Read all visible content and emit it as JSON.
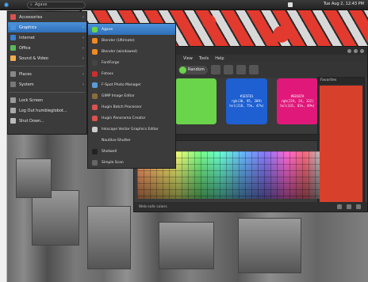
{
  "colors": {
    "accent": "#3a7fd0",
    "scheme_green": "#6ad44a",
    "swatch_blue": "#1e5fd1",
    "swatch_magenta": "#e0187a",
    "swatch_red": "#d7412c",
    "menu_bg": "#3b3b3b"
  },
  "topbar": {
    "search_label": "Agave",
    "clock": "Tue Aug 2, 12:43 PM"
  },
  "menu": {
    "items": [
      {
        "label": "Accessories",
        "icon": "accessories-icon",
        "color": "#d9534f",
        "submenu": true
      },
      {
        "label": "Graphics",
        "icon": "graphics-icon",
        "color": "#4a90d9",
        "submenu": true,
        "active": true
      },
      {
        "label": "Internet",
        "icon": "internet-icon",
        "color": "#3a7fd0",
        "submenu": true
      },
      {
        "label": "Office",
        "icon": "office-icon",
        "color": "#5cb85c",
        "submenu": true
      },
      {
        "label": "Sound & Video",
        "icon": "media-icon",
        "color": "#f0ad4e",
        "submenu": true
      },
      {
        "label": "Places",
        "icon": "folder-icon",
        "color": "#888888",
        "submenu": true
      },
      {
        "label": "System",
        "icon": "system-icon",
        "color": "#777777",
        "submenu": true
      },
      {
        "label": "Lock Screen",
        "icon": "lock-icon",
        "color": "#999999",
        "submenu": false
      },
      {
        "label": "Log Out humbleglobot...",
        "icon": "logout-icon",
        "color": "#aaaaaa",
        "submenu": false
      },
      {
        "label": "Shut Down...",
        "icon": "power-icon",
        "color": "#bbbbbb",
        "submenu": false
      }
    ]
  },
  "submenu": {
    "items": [
      {
        "label": "Agave",
        "icon": "agave-icon",
        "color": "#6ad44a",
        "active": true
      },
      {
        "label": "Blender (Ultimate)",
        "icon": "blender-icon",
        "color": "#f08a24"
      },
      {
        "label": "Blender (windowed)",
        "icon": "blender-icon",
        "color": "#f08a24"
      },
      {
        "label": "FontForge",
        "icon": "fontforge-icon",
        "color": "#444444"
      },
      {
        "label": "Fotoxx",
        "icon": "fotoxx-icon",
        "color": "#c9302c"
      },
      {
        "label": "F-Spot Photo Manager",
        "icon": "fspot-icon",
        "color": "#5b9bd5"
      },
      {
        "label": "GIMP Image Editor",
        "icon": "gimp-icon",
        "color": "#8a6d3b"
      },
      {
        "label": "Hugin Batch Processor",
        "icon": "hugin-icon",
        "color": "#d9534f"
      },
      {
        "label": "Hugin Panorama Creator",
        "icon": "hugin-icon",
        "color": "#d9534f"
      },
      {
        "label": "Inkscape Vector Graphics Editor",
        "icon": "inkscape-icon",
        "color": "#cccccc"
      },
      {
        "label": "Nautilus-Shutter",
        "icon": "shutter-icon",
        "color": "#3a3a3a"
      },
      {
        "label": "Shotwell",
        "icon": "shotwell-icon",
        "color": "#222222"
      },
      {
        "label": "Simple Scan",
        "icon": "scan-icon",
        "color": "#666666"
      }
    ]
  },
  "app": {
    "menubar": [
      "View",
      "Tools",
      "Help"
    ],
    "scheme_button": "Random",
    "swatches": [
      {
        "hex": "#1E5FD1",
        "line2": "rgb(30, 95, 209)",
        "line3": "hsl(218, 75%, 47%)",
        "bg": "#1e5fd1"
      },
      {
        "hex": "#E0187A",
        "line2": "rgb(224, 24, 122)",
        "line3": "hsl(331, 81%, 49%)",
        "bg": "#e0187a"
      }
    ],
    "right_panel_title": "Favorites",
    "bottom_label": "Web-safe colors"
  }
}
